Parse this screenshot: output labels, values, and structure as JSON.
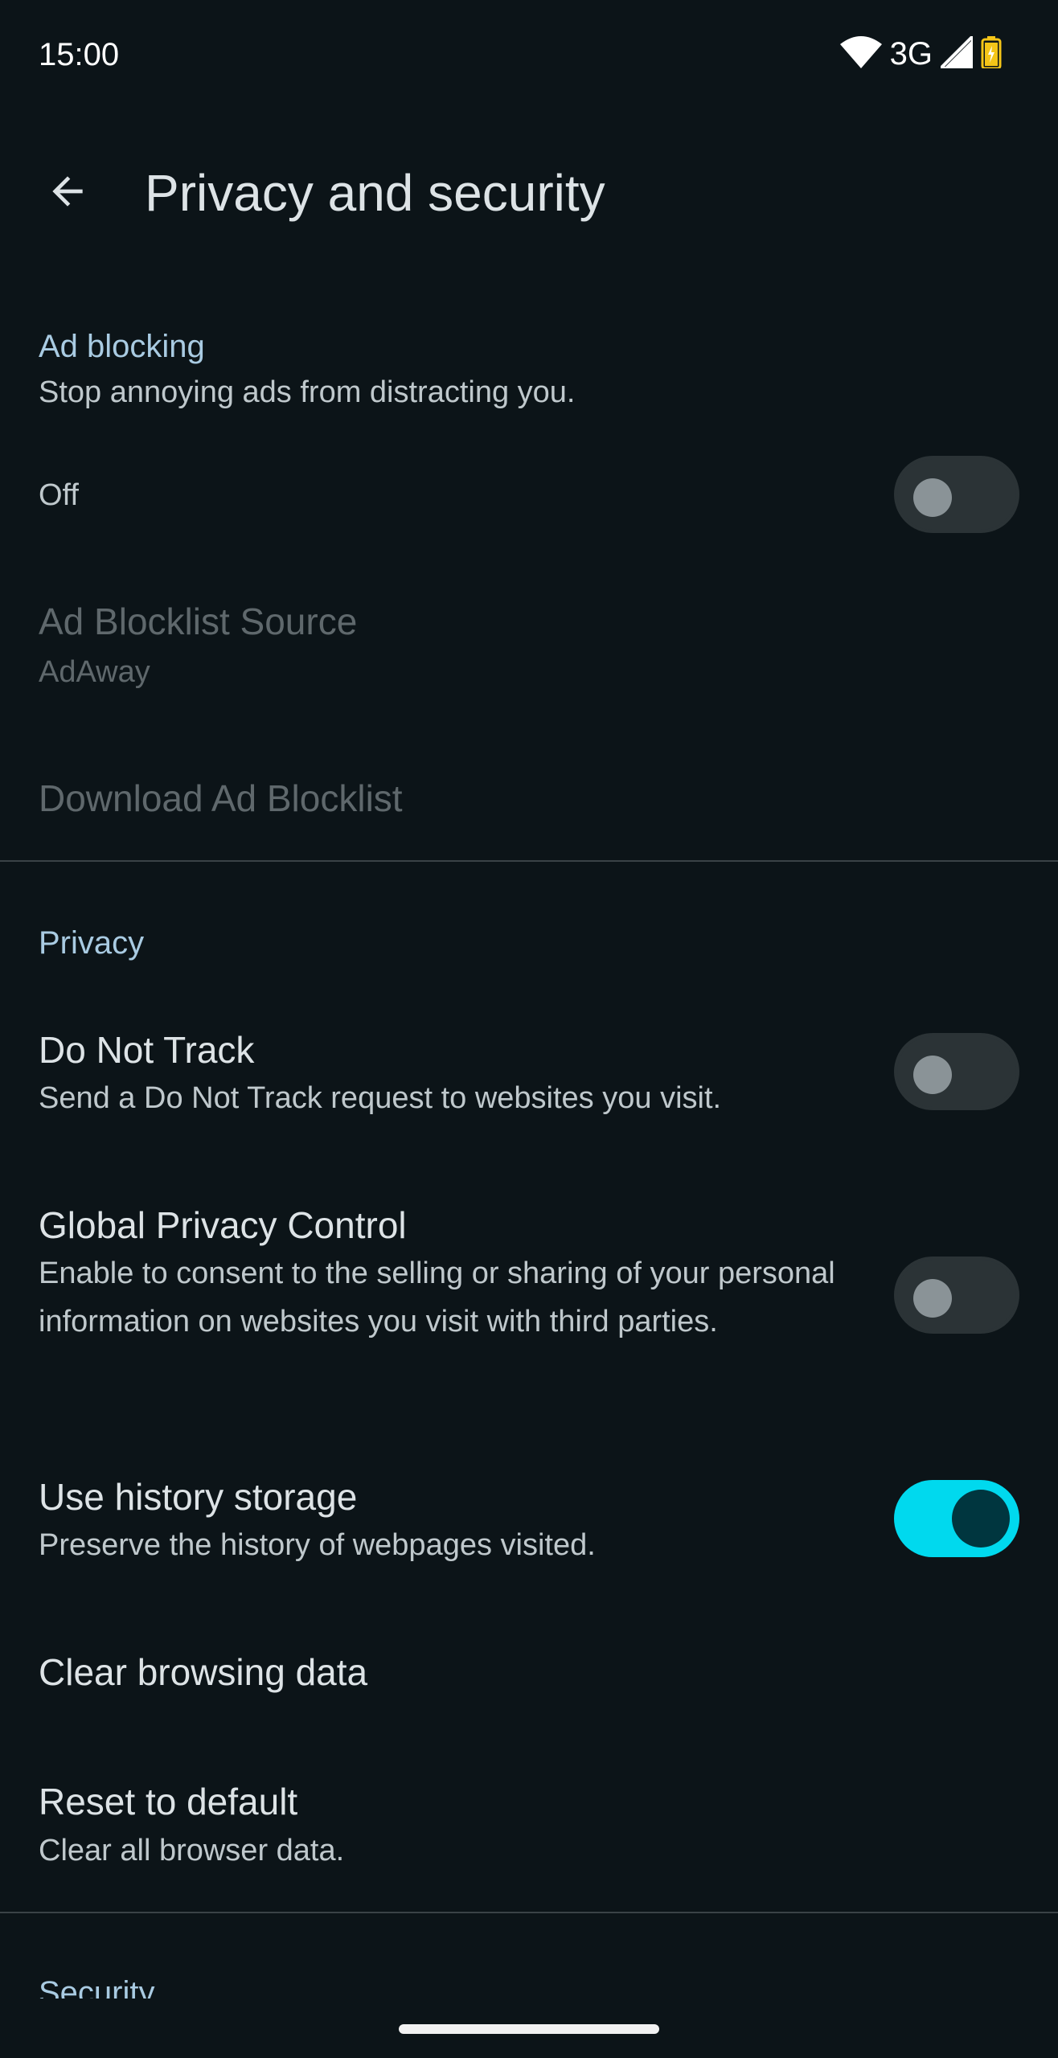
{
  "status_bar": {
    "time": "15:00",
    "network": "3G"
  },
  "app_bar": {
    "title": "Privacy and security"
  },
  "ad_blocking": {
    "header": "Ad blocking",
    "description": "Stop annoying ads from distracting you.",
    "toggle_label": "Off",
    "toggle_on": false,
    "blocklist_source_title": "Ad Blocklist Source",
    "blocklist_source_value": "AdAway",
    "download_title": "Download Ad Blocklist"
  },
  "privacy": {
    "header": "Privacy",
    "do_not_track": {
      "title": "Do Not Track",
      "summary": "Send a Do Not Track request to websites you visit.",
      "on": false
    },
    "global_privacy_control": {
      "title": "Global Privacy Control",
      "summary": "Enable to consent to the selling or sharing of your personal information on websites you visit with third parties.",
      "on": false
    },
    "history_storage": {
      "title": "Use history storage",
      "summary": "Preserve the history of webpages visited.",
      "on": true
    },
    "clear_browsing_data": {
      "title": "Clear browsing data"
    },
    "reset_to_default": {
      "title": "Reset to default",
      "summary": "Clear all browser data."
    }
  },
  "security": {
    "header": "Security"
  },
  "colors": {
    "background": "#0c1418",
    "accent": "#00d9ee",
    "section_header": "#a9cbe2"
  }
}
